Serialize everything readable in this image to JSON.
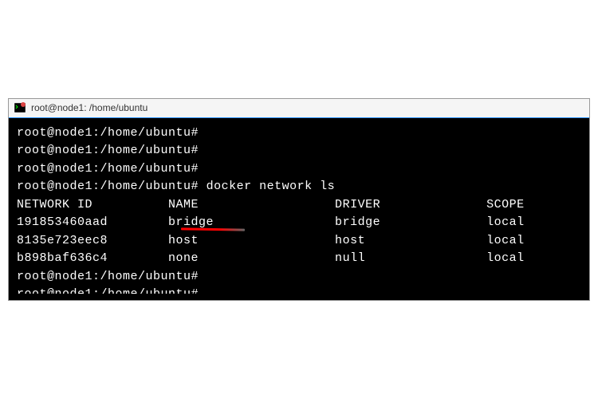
{
  "titlebar": {
    "title": "root@node1: /home/ubuntu"
  },
  "terminal": {
    "prompt": "root@node1:/home/ubuntu#",
    "command": "docker network ls",
    "table": {
      "headers": {
        "id": "NETWORK ID",
        "name": "NAME",
        "driver": "DRIVER",
        "scope": "SCOPE"
      },
      "rows": [
        {
          "id": "191853460aad",
          "name": "bridge",
          "driver": "bridge",
          "scope": "local"
        },
        {
          "id": "8135e723eec8",
          "name": "host",
          "driver": "host",
          "scope": "local"
        },
        {
          "id": "b898baf636c4",
          "name": "none",
          "driver": "null",
          "scope": "local"
        }
      ]
    }
  },
  "colors": {
    "terminal_bg": "#000000",
    "terminal_fg": "#ffffff",
    "titlebar_bg": "#f5f5f5",
    "highlight": "#ff0000"
  }
}
